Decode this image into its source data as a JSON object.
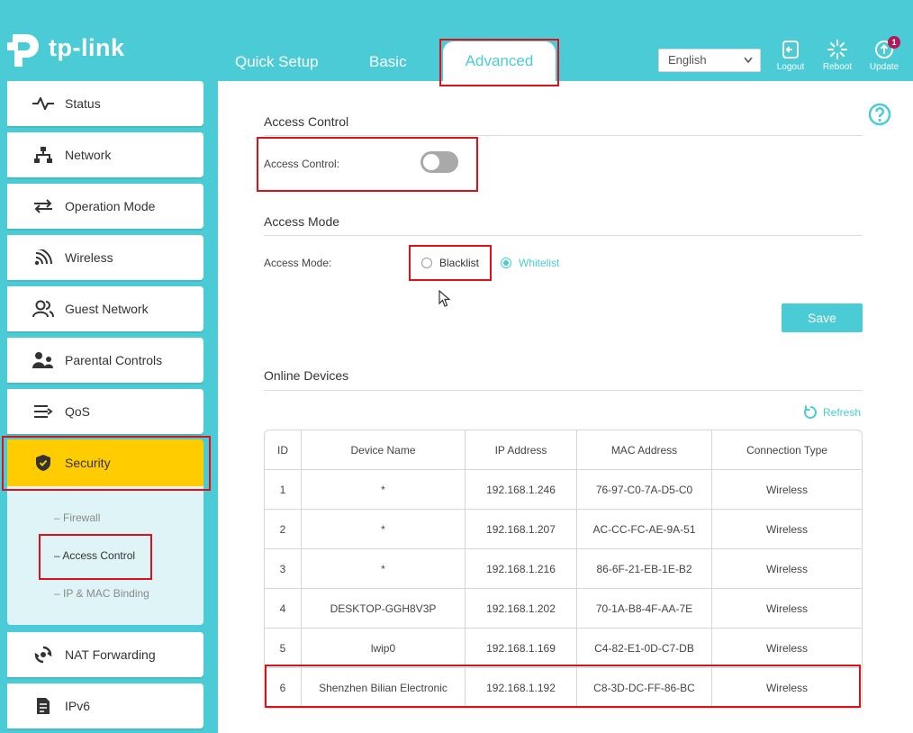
{
  "brand": {
    "name": "tp-link"
  },
  "top_nav": {
    "tabs": [
      {
        "label": "Quick Setup"
      },
      {
        "label": "Basic"
      },
      {
        "label": "Advanced",
        "active": true
      }
    ],
    "language": "English",
    "buttons": {
      "logout": "Logout",
      "reboot": "Reboot",
      "update": "Update",
      "update_badge": "1"
    }
  },
  "sidebar": {
    "items": [
      {
        "label": "Status",
        "icon": "pulse-icon"
      },
      {
        "label": "Network",
        "icon": "network-icon"
      },
      {
        "label": "Operation Mode",
        "icon": "operation-mode-icon"
      },
      {
        "label": "Wireless",
        "icon": "wifi-icon"
      },
      {
        "label": "Guest Network",
        "icon": "guest-icon"
      },
      {
        "label": "Parental Controls",
        "icon": "parental-icon"
      },
      {
        "label": "QoS",
        "icon": "qos-icon"
      },
      {
        "label": "Security",
        "icon": "shield-icon",
        "active": true
      },
      {
        "label": "NAT Forwarding",
        "icon": "nat-icon"
      },
      {
        "label": "IPv6",
        "icon": "ipv6-icon"
      }
    ],
    "security_submenu": [
      {
        "label": "Firewall"
      },
      {
        "label": "Access Control",
        "current": true
      },
      {
        "label": "IP & MAC Binding"
      }
    ]
  },
  "access_control": {
    "section_title": "Access Control",
    "toggle_label": "Access Control:",
    "enabled": false
  },
  "access_mode": {
    "section_title": "Access Mode",
    "label": "Access Mode:",
    "options": [
      {
        "label": "Blacklist",
        "checked": false
      },
      {
        "label": "Whitelist",
        "checked": true
      }
    ],
    "save_label": "Save"
  },
  "online_devices": {
    "section_title": "Online Devices",
    "refresh_label": "Refresh",
    "columns": [
      "ID",
      "Device Name",
      "IP Address",
      "MAC Address",
      "Connection Type"
    ],
    "rows": [
      [
        "1",
        "*",
        "192.168.1.246",
        "76-97-C0-7A-D5-C0",
        "Wireless"
      ],
      [
        "2",
        "*",
        "192.168.1.207",
        "AC-CC-FC-AE-9A-51",
        "Wireless"
      ],
      [
        "3",
        "*",
        "192.168.1.216",
        "86-6F-21-EB-1E-B2",
        "Wireless"
      ],
      [
        "4",
        "DESKTOP-GGH8V3P",
        "192.168.1.202",
        "70-1A-B8-4F-AA-7E",
        "Wireless"
      ],
      [
        "5",
        "lwip0",
        "192.168.1.169",
        "C4-82-E1-0D-C7-DB",
        "Wireless"
      ],
      [
        "6",
        "Shenzhen Bilian Electronic",
        "192.168.1.192",
        "C8-3D-DC-FF-86-BC",
        "Wireless"
      ]
    ]
  },
  "colors": {
    "teal": "#4acbd6",
    "active_nav": "#ffcc00",
    "annotation_red": "#e0101a",
    "badge": "#b0185a"
  }
}
